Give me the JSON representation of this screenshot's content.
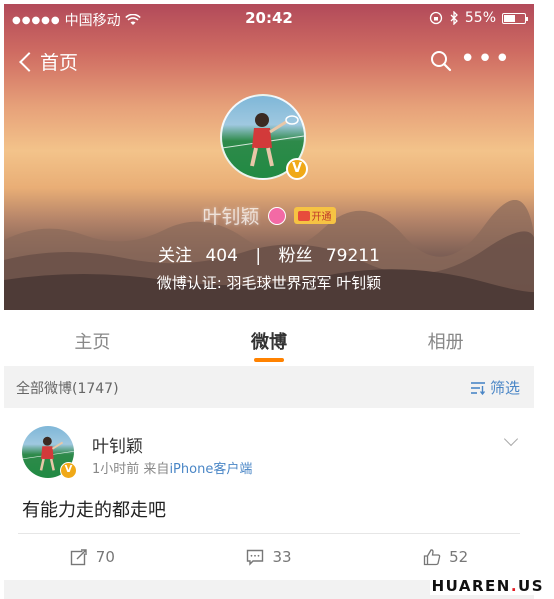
{
  "status_bar": {
    "carrier": "中国移动",
    "time": "20:42",
    "battery_percent": "55%",
    "battery_level": 0.55,
    "icons": [
      "signal-dots-icon",
      "wifi-icon",
      "lock-rotation-icon",
      "bluetooth-icon",
      "battery-icon"
    ]
  },
  "nav": {
    "back_label": "首页"
  },
  "profile": {
    "name": "叶钊颖",
    "vip_label": "开通",
    "following_label": "关注",
    "following_count": "404",
    "separator": "|",
    "followers_label": "粉丝",
    "followers_count": "79211",
    "verification": "微博认证: 羽毛球世界冠军 叶钊颖",
    "verified_badge": "V"
  },
  "tabs": [
    {
      "label": "主页",
      "active": false
    },
    {
      "label": "微博",
      "active": true
    },
    {
      "label": "相册",
      "active": false
    }
  ],
  "filter": {
    "all_label": "全部微博(1747)",
    "filter_label": "筛选"
  },
  "post": {
    "author": "叶钊颖",
    "time": "1小时前",
    "source_prefix": "来自",
    "source": "iPhone客户端",
    "text": "有能力走的都走吧",
    "verified_badge": "V",
    "reposts": "70",
    "comments": "33",
    "likes": "52"
  },
  "watermark": {
    "part1": "HUAREN",
    "dot": ".",
    "part2": "US"
  },
  "colors": {
    "accent": "#ff8200",
    "link": "#4a86c6",
    "verified": "#f0a918"
  }
}
